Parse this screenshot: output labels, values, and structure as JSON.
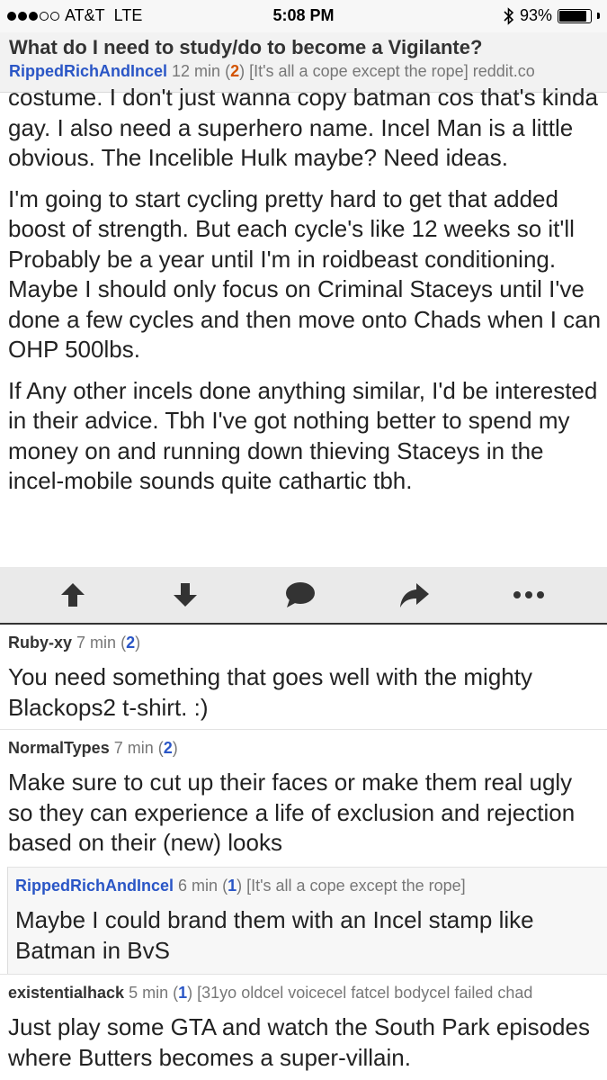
{
  "status_bar": {
    "carrier": "AT&T",
    "network": "LTE",
    "time": "5:08 PM",
    "battery": "93%",
    "battery_level": 0.93,
    "signal_bars_filled": 3,
    "signal_bars_total": 5
  },
  "post": {
    "title": "What do I need to study/do to become a Vigilante?",
    "author": "RippedRichAndIncel",
    "age": "12 min",
    "count_open": "(",
    "comment_count": "2",
    "count_close": ")",
    "flair": "[It's all a cope except the rope]",
    "domain": "reddit.co",
    "paragraphs": [
      "costume. I don't just wanna copy batman cos that's kinda gay. I also need a superhero name. Incel Man is a little obvious. The Incelible Hulk maybe? Need ideas.",
      "I'm going to start cycling pretty hard to get that added boost of strength. But each cycle's like 12 weeks so it'll Probably be a year until I'm in roidbeast conditioning. Maybe I should only focus on Criminal Staceys until I've done a few cycles and then move onto Chads when I can OHP 500lbs.",
      "If Any other incels done  anything similar, I'd be interested in their advice. Tbh I've got nothing better to spend my money on and running down thieving Staceys in the incel-mobile sounds quite cathartic tbh."
    ]
  },
  "actions": [
    "upvote-icon",
    "downvote-icon",
    "comment-icon",
    "share-icon",
    "more-icon"
  ],
  "comments": [
    {
      "author": "Ruby-xy",
      "age": "7 min",
      "count": "2",
      "text": "You need something that goes well with the mighty Blackops2 t-shirt. :)"
    },
    {
      "author": "NormalTypes",
      "age": "7 min",
      "count": "2",
      "text": "Make sure to cut up their faces or make them real ugly so they can experience a life of exclusion and rejection based on their (new) looks"
    },
    {
      "author": "RippedRichAndIncel",
      "age": "6 min",
      "count": "1",
      "flair": "[It's all a cope except the rope]",
      "text": "Maybe I could brand them with an Incel stamp like Batman in BvS"
    },
    {
      "author": "existentialhack",
      "age": "5 min",
      "count": "1",
      "flair": "[31yo oldcel voicecel fatcel bodycel failed chad",
      "text": "Just play some GTA and watch the South Park episodes where Butters becomes a super-villain."
    }
  ],
  "colors": {
    "author_blue": "#2a56c6",
    "op_count_orange": "#d35400",
    "action_icon": "#333333"
  }
}
